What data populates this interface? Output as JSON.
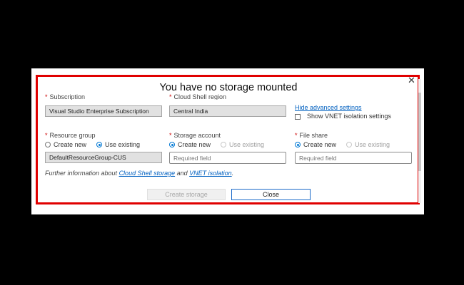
{
  "dialog": {
    "title": "You have no storage mounted",
    "close_glyph": "✕"
  },
  "fields": {
    "subscription": {
      "label": "Subscription",
      "value": "Visual Studio Enterprise Subscription"
    },
    "region": {
      "label": "Cloud Shell region",
      "value": "Central India"
    },
    "resource_group": {
      "label": "Resource group",
      "option_new": "Create new",
      "option_existing": "Use existing",
      "selected": "Use existing",
      "value": "DefaultResourceGroup-CUS"
    },
    "storage_account": {
      "label": "Storage account",
      "option_new": "Create new",
      "option_existing": "Use existing",
      "selected": "Create new",
      "placeholder": "Required field"
    },
    "file_share": {
      "label": "File share",
      "option_new": "Create new",
      "option_existing": "Use existing",
      "selected": "Create new",
      "placeholder": "Required field"
    }
  },
  "advanced": {
    "hide_link": "Hide advanced settings",
    "vnet_checkbox_label": "Show VNET isolation settings",
    "vnet_checked": false
  },
  "info": {
    "prefix": "Further information about ",
    "link1": "Cloud Shell storage",
    "middle": " and ",
    "link2": "VNET isolation",
    "suffix": "."
  },
  "buttons": {
    "create": "Create storage",
    "close": "Close"
  },
  "icons": {
    "close": "close-icon"
  },
  "colors": {
    "highlight_border": "#e00000",
    "link": "#0060c0",
    "primary": "#0078d4"
  }
}
